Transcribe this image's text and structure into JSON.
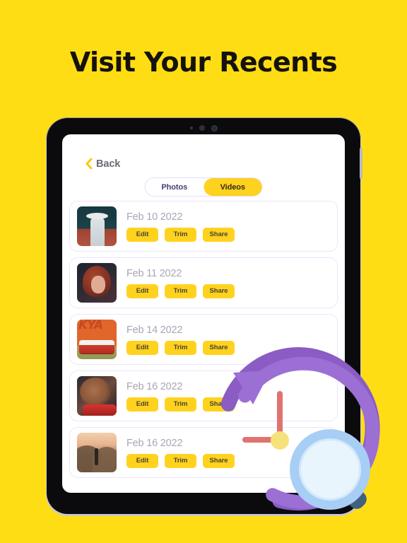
{
  "page": {
    "title": "Visit Your Recents",
    "background_color": "#FFDD14",
    "accent_color": "#FFD21E"
  },
  "device": {
    "type": "tablet",
    "bezel_color": "#0b0b0d",
    "screen_background": "#ffffff"
  },
  "screen": {
    "back": {
      "label": "Back",
      "icon": "chevron-left-icon",
      "icon_color": "#FFC400"
    },
    "segmented_control": {
      "options": [
        {
          "label": "Photos",
          "active": false
        },
        {
          "label": "Videos",
          "active": true
        }
      ],
      "active_color": "#FFD21E"
    },
    "list": {
      "action_labels": [
        "Edit",
        "Trim",
        "Share"
      ],
      "rows": [
        {
          "date": "Feb 10 2022",
          "thumb": "man-in-cowboy-hat",
          "thumb_class": "t-cowboy"
        },
        {
          "date": "Feb 11 2022",
          "thumb": "woman-with-red-hair",
          "thumb_class": "t-redhair"
        },
        {
          "date": "Feb 14 2022",
          "thumb": "red-vw-van-kya-wall",
          "thumb_class": "t-van"
        },
        {
          "date": "Feb 16 2022",
          "thumb": "woman-in-red-top",
          "thumb_class": "t-girl"
        },
        {
          "date": "Feb 16 2022",
          "thumb": "hiker-at-sunset",
          "thumb_class": "t-hike"
        }
      ]
    }
  },
  "decorations": {
    "history_arrow": {
      "name": "circular-history-arrow",
      "color": "#9B6FD4",
      "shade_color": "#8A5CC4"
    },
    "clock_hands": {
      "name": "clock-hands",
      "hand_color": "#E0736F",
      "hub_color": "#F5E27A"
    },
    "magnifier": {
      "name": "magnifying-glass-icon",
      "ring_color": "#A8CEF5",
      "lens_color": "#E8F5FD",
      "handle_color": "#3F6080"
    }
  }
}
